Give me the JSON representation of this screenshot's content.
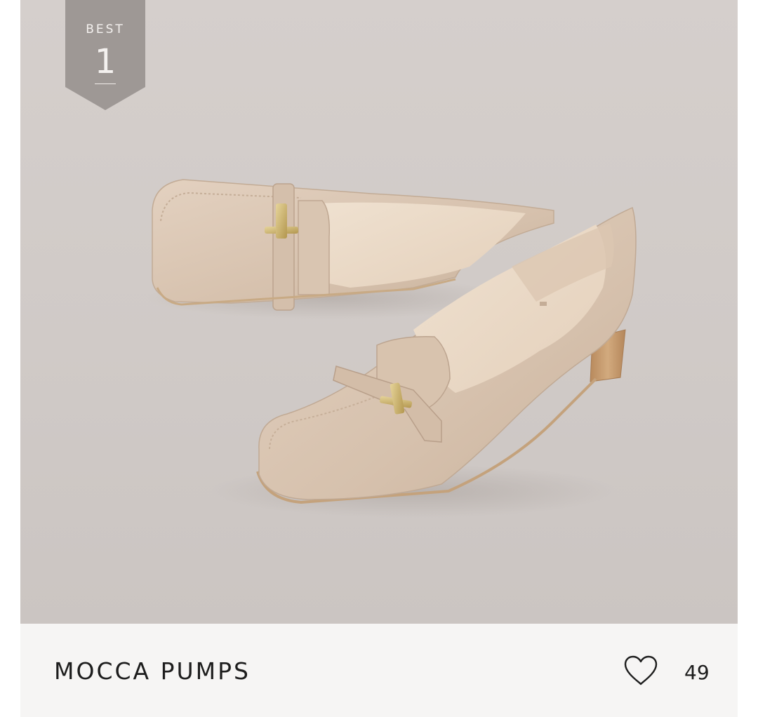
{
  "badge": {
    "label": "BEST",
    "rank": "1"
  },
  "product": {
    "name": "MOCCA PUMPS",
    "image_subject": "beige-leather-loafer-pumps",
    "like_icon": "heart-outline-icon",
    "like_count": "49"
  },
  "colors": {
    "background": "#d2ccc9",
    "badge": "#9e9895",
    "info_bar": "#f6f5f4",
    "text": "#1d1d1d",
    "shoe_leather": "#d8c4b1",
    "shoe_lining": "#ecdcc9",
    "heel_wood": "#c49a6c",
    "buckle_gold": "#cdb36c"
  }
}
